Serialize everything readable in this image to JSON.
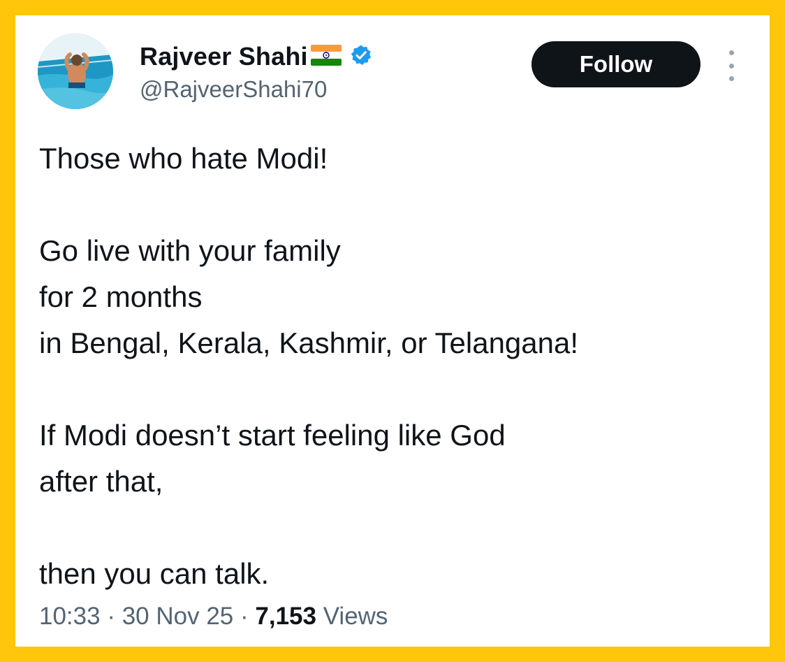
{
  "tweet": {
    "author": {
      "display_name": "Rajveer Shahi",
      "handle": "@RajveerShahi70",
      "verified": true,
      "avatar_icon": "pool-photo-avatar",
      "badge_icon": "india-flag-icon"
    },
    "follow_label": "Follow",
    "more_icon": "vertical-ellipsis-icon",
    "paragraphs": [
      "Those who hate Modi!",
      "Go live with your family\nfor 2 months\nin Bengal, Kerala, Kashmir, or Telangana!",
      "If Modi doesn’t start feeling like God\nafter that,",
      "then you can talk."
    ],
    "time": "10:33",
    "date": "30 Nov 25",
    "separator": " · ",
    "views_count": "7,153",
    "views_label": "Views"
  },
  "colors": {
    "frame": "#FFC60B",
    "card": "#FFFFFF",
    "text": "#0F1419",
    "secondary": "#536471",
    "verified": "#1D9BF0",
    "button": "#0F1419"
  }
}
